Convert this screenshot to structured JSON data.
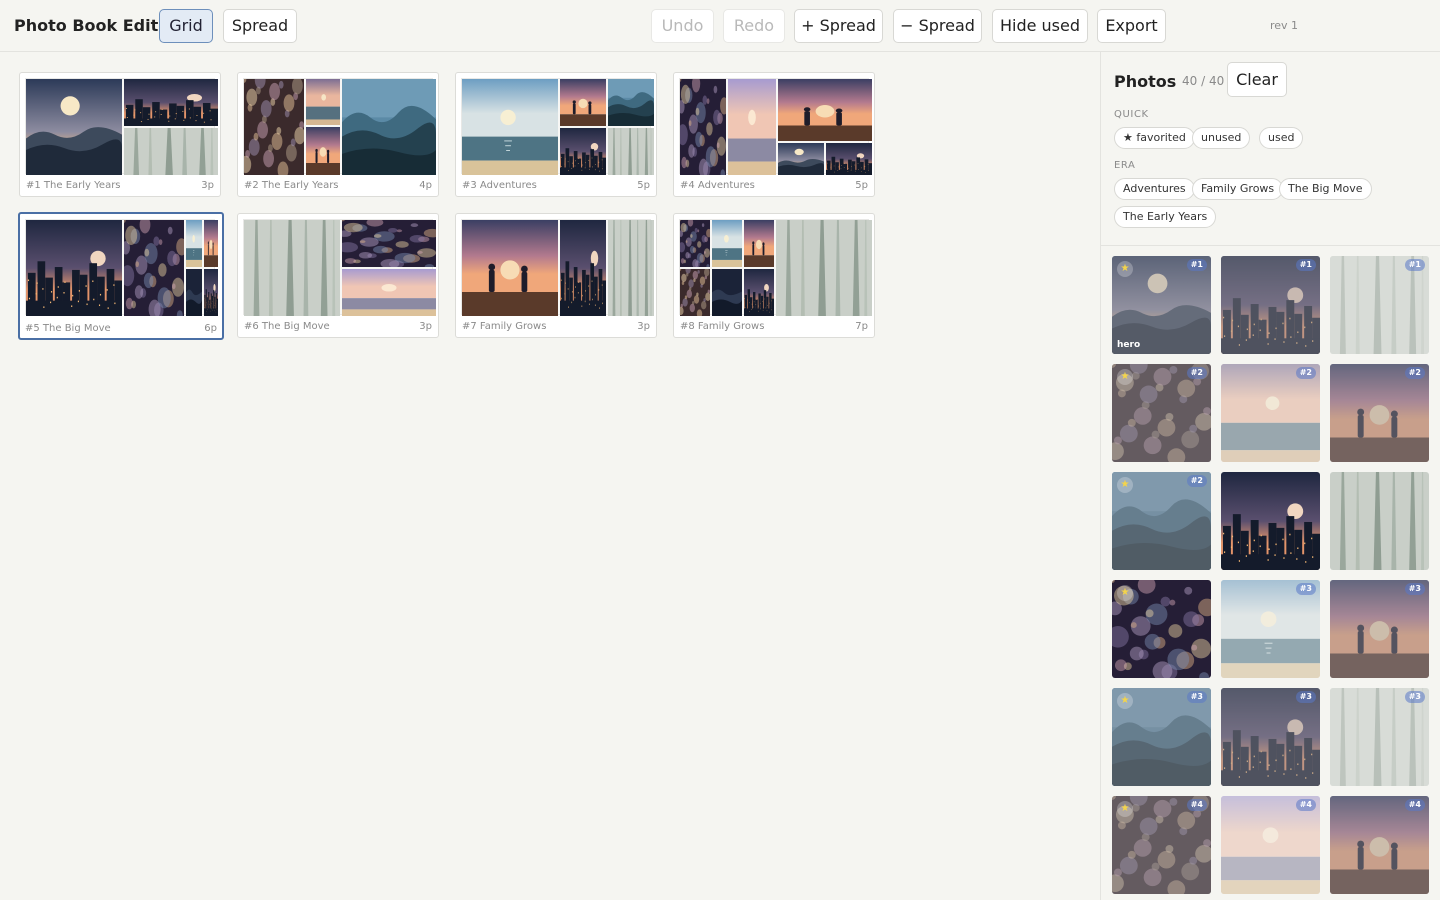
{
  "app": {
    "title": "Photo Book Editor",
    "revision": "rev 1"
  },
  "toolbar": {
    "view_grid": "Grid",
    "view_spread": "Spread",
    "undo": "Undo",
    "redo": "Redo",
    "add_spread": "+ Spread",
    "remove_spread": "− Spread",
    "hide_used": "Hide used",
    "export": "Export",
    "active_view": "Grid",
    "undo_enabled": false,
    "redo_enabled": false
  },
  "spreads": [
    {
      "label": "#1 The Early Years",
      "pages": "3p",
      "selected": false,
      "photos": [
        {
          "scene": "mountain-dusk"
        },
        {
          "scene": "city-dusk"
        },
        {
          "scene": "forest-mist"
        }
      ]
    },
    {
      "label": "#2 The Early Years",
      "pages": "4p",
      "selected": false,
      "photos": [
        {
          "scene": "bokeh-warm"
        },
        {
          "scene": "sea-dusk"
        },
        {
          "scene": "people-dusk"
        },
        {
          "scene": "mountain-teal"
        }
      ]
    },
    {
      "label": "#3 Adventures",
      "pages": "5p",
      "selected": false,
      "photos": [
        {
          "scene": "sea-day"
        },
        {
          "scene": "people-dusk"
        },
        {
          "scene": "mountain-teal"
        },
        {
          "scene": "city-dusk"
        },
        {
          "scene": "forest-mist"
        }
      ]
    },
    {
      "label": "#4 Adventures",
      "pages": "5p",
      "selected": false,
      "photos": [
        {
          "scene": "bokeh-dark"
        },
        {
          "scene": "sea-lilac"
        },
        {
          "scene": "people-dusk"
        },
        {
          "scene": "mountain-dusk"
        },
        {
          "scene": "city-dusk"
        }
      ]
    },
    {
      "label": "#5 The Big Move",
      "pages": "6p",
      "selected": true,
      "photos": [
        {
          "scene": "city-dusk"
        },
        {
          "scene": "bokeh-dark"
        },
        {
          "scene": "sea-day"
        },
        {
          "scene": "people-dusk"
        },
        {
          "scene": "mountain-dark"
        },
        {
          "scene": "city-dusk"
        }
      ]
    },
    {
      "label": "#6 The Big Move",
      "pages": "3p",
      "selected": false,
      "photos": [
        {
          "scene": "forest-mist"
        },
        {
          "scene": "bokeh-dark"
        },
        {
          "scene": "sea-lilac"
        }
      ]
    },
    {
      "label": "#7 Family Grows",
      "pages": "3p",
      "selected": false,
      "photos": [
        {
          "scene": "people-dusk"
        },
        {
          "scene": "city-dusk"
        },
        {
          "scene": "forest-mist"
        }
      ]
    },
    {
      "label": "#8 Family Grows",
      "pages": "7p",
      "selected": false,
      "photos": [
        {
          "scene": "bokeh-dark"
        },
        {
          "scene": "sea-day"
        },
        {
          "scene": "people-dusk"
        },
        {
          "scene": "bokeh-warm"
        },
        {
          "scene": "mountain-dark"
        },
        {
          "scene": "city-dusk"
        },
        {
          "scene": "forest-mist"
        }
      ]
    }
  ],
  "panel": {
    "title": "Photos",
    "count": "40 / 40",
    "clear_label": "Clear",
    "quick_heading": "QUICK",
    "quick_filters": [
      "★ favorited",
      "unused",
      "used"
    ],
    "era_heading": "ERA",
    "era_filters": [
      "Adventures",
      "Family Grows",
      "The Big Move",
      "The Early Years"
    ],
    "photos": [
      {
        "scene": "mountain-dusk",
        "tint": "muted",
        "favorite": true,
        "spread": "#1",
        "label": "hero"
      },
      {
        "scene": "city-dusk",
        "tint": "muted",
        "favorite": false,
        "spread": "#1",
        "label": ""
      },
      {
        "scene": "forest-mist",
        "tint": "pale",
        "favorite": false,
        "spread": "#1",
        "label": ""
      },
      {
        "scene": "bokeh-warm",
        "tint": "muted",
        "favorite": true,
        "spread": "#2",
        "label": ""
      },
      {
        "scene": "sea-dusk",
        "tint": "pale",
        "favorite": false,
        "spread": "#2",
        "label": ""
      },
      {
        "scene": "people-dusk",
        "tint": "muted",
        "favorite": false,
        "spread": "#2",
        "label": ""
      },
      {
        "scene": "mountain-teal",
        "tint": "muted",
        "favorite": true,
        "spread": "#2",
        "label": ""
      },
      {
        "scene": "city-dusk",
        "tint": "full",
        "favorite": false,
        "spread": "",
        "label": ""
      },
      {
        "scene": "forest-mist",
        "tint": "full",
        "favorite": false,
        "spread": "",
        "label": ""
      },
      {
        "scene": "bokeh-dark",
        "tint": "full",
        "favorite": true,
        "spread": "",
        "label": ""
      },
      {
        "scene": "sea-day",
        "tint": "pale",
        "favorite": false,
        "spread": "#3",
        "label": ""
      },
      {
        "scene": "people-dusk",
        "tint": "muted",
        "favorite": false,
        "spread": "#3",
        "label": ""
      },
      {
        "scene": "mountain-teal",
        "tint": "muted",
        "favorite": true,
        "spread": "#3",
        "label": ""
      },
      {
        "scene": "city-dusk",
        "tint": "muted",
        "favorite": false,
        "spread": "#3",
        "label": ""
      },
      {
        "scene": "forest-mist",
        "tint": "pale",
        "favorite": false,
        "spread": "#3",
        "label": ""
      },
      {
        "scene": "bokeh-warm",
        "tint": "muted",
        "favorite": true,
        "spread": "#4",
        "label": ""
      },
      {
        "scene": "sea-lilac",
        "tint": "pale",
        "favorite": false,
        "spread": "#4",
        "label": ""
      },
      {
        "scene": "people-dusk",
        "tint": "muted",
        "favorite": false,
        "spread": "#4",
        "label": ""
      }
    ]
  },
  "colors": {
    "accent": "#4a6fa5",
    "active_button_bg": "#e3ebf5",
    "star": "#f4d44a",
    "tag_bg": "#7e96cc"
  }
}
